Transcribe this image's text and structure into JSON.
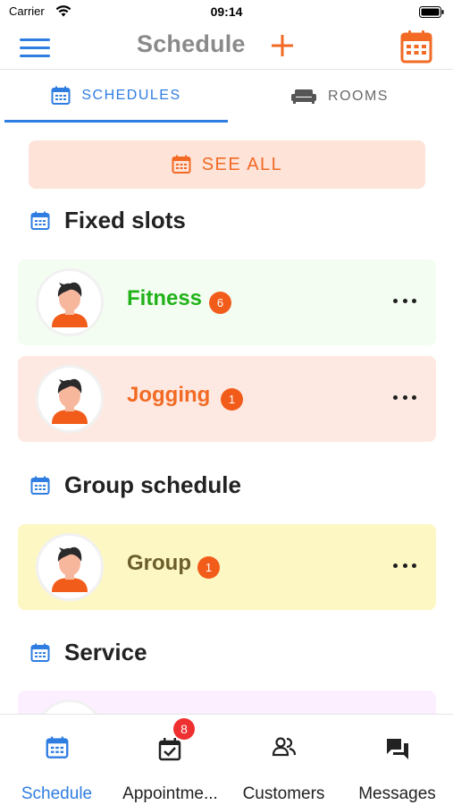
{
  "status_bar": {
    "carrier": "Carrier",
    "time": "09:14"
  },
  "header": {
    "title": "Schedule",
    "icons": [
      "menu-icon",
      "plus-icon",
      "calendar-icon"
    ]
  },
  "tabs": [
    {
      "label": "SCHEDULES",
      "icon": "calendar-icon",
      "active": true
    },
    {
      "label": "ROOMS",
      "icon": "sofa-icon",
      "active": false
    }
  ],
  "see_all": {
    "label": "SEE ALL",
    "icon": "calendar-icon"
  },
  "sections": [
    {
      "title": "Fixed slots",
      "items": [
        {
          "name": "Fitness",
          "count": "6",
          "name_color": "#21b21a",
          "bg": "#f4fdf2"
        },
        {
          "name": "Jogging",
          "count": "1",
          "name_color": "#f26a24",
          "bg": "#fde9e1"
        }
      ]
    },
    {
      "title": "Group schedule",
      "items": [
        {
          "name": "Group",
          "count": "1",
          "name_color": "#6b5e2a",
          "bg": "#fdf7c4"
        }
      ]
    },
    {
      "title": "Service",
      "items": []
    }
  ],
  "bottom_nav": [
    {
      "label": "Schedule",
      "icon": "calendar-icon",
      "active": true
    },
    {
      "label": "Appointme...",
      "icon": "calendar-check-icon",
      "badge": "8"
    },
    {
      "label": "Customers",
      "icon": "people-icon"
    },
    {
      "label": "Messages",
      "icon": "chat-icon"
    }
  ],
  "colors": {
    "accent": "#2f7de1",
    "orange": "#f26a24",
    "badge": "#f25c1a",
    "nav_badge": "#ef3030"
  }
}
